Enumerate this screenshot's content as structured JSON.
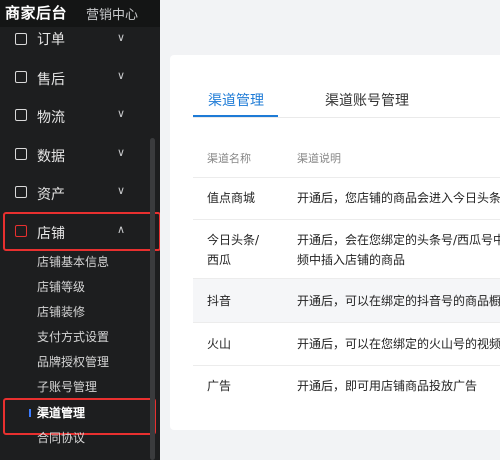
{
  "header": {
    "brand": "商家后台",
    "subtitle": "营销中心"
  },
  "sidebar": {
    "items": [
      {
        "label": "订单",
        "icon": "order-icon"
      },
      {
        "label": "售后",
        "icon": "after-sales-icon"
      },
      {
        "label": "物流",
        "icon": "truck-icon"
      },
      {
        "label": "数据",
        "icon": "bar-chart-icon"
      },
      {
        "label": "资产",
        "icon": "wallet-icon"
      },
      {
        "label": "店铺",
        "icon": "store-icon"
      }
    ],
    "sub_items": [
      "店铺基本信息",
      "店铺等级",
      "店铺装修",
      "支付方式设置",
      "品牌授权管理",
      "子账号管理",
      "渠道管理",
      "合同协议"
    ]
  },
  "tabs": [
    "渠道管理",
    "渠道账号管理"
  ],
  "table": {
    "headers": [
      "渠道名称",
      "渠道说明"
    ],
    "rows": [
      {
        "name": "值点商城",
        "desc": "开通后，您店铺的商品会进入今日头条/"
      },
      {
        "name": "今日头条/\n西瓜",
        "desc": "开通后，会在您绑定的头条号/西瓜号中\n频中插入店铺的商品"
      },
      {
        "name": "抖音",
        "desc": "开通后，可以在绑定的抖音号的商品橱窗"
      },
      {
        "name": "火山",
        "desc": "开通后，可以在您绑定的火山号的视频、"
      },
      {
        "name": "广告",
        "desc": "开通后，即可用店铺商品投放广告"
      }
    ]
  }
}
